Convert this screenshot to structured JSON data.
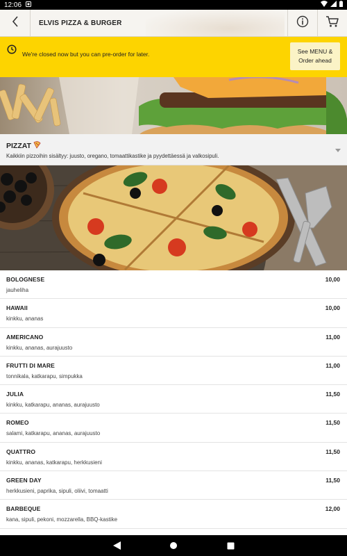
{
  "status_bar": {
    "time": "12:06",
    "icons": [
      "notification-icon",
      "wifi-icon",
      "signal-icon",
      "battery-icon"
    ]
  },
  "header": {
    "title": "ELVIS PIZZA & BURGER",
    "back_icon": "chevron-left-icon",
    "info_icon": "info-icon",
    "cart_icon": "cart-icon"
  },
  "closed_banner": {
    "message": "We're closed now but you can pre-order for later.",
    "button_line1": "See MENU &",
    "button_line2": "Order ahead",
    "background": "#fdd400"
  },
  "category": {
    "title": "PIZZAT",
    "title_icon": "pizza-icon",
    "description": "Kaikkiin pizzoihin sisältyy: juusto, oregano, tomaattikastike ja pyydettäessä ja valkosipuli."
  },
  "menu_items": [
    {
      "name": "BOLOGNESE",
      "desc": "jauheliha",
      "price": "10,00"
    },
    {
      "name": "HAWAII",
      "desc": "kinkku, ananas",
      "price": "10,00"
    },
    {
      "name": "AMERICANO",
      "desc": "kinkku, ananas, aurajuusto",
      "price": "11,00"
    },
    {
      "name": "FRUTTI DI MARE",
      "desc": "tonnikala, katkarapu, simpukka",
      "price": "11,00"
    },
    {
      "name": "JULIA",
      "desc": "kinkku, katkarapu, ananas, aurajuusto",
      "price": "11,50"
    },
    {
      "name": "ROMEO",
      "desc": "salami, katkarapu, ananas, aurajuusto",
      "price": "11,50"
    },
    {
      "name": "QUATTRO",
      "desc": "kinkku, ananas, katkarapu, herkkusieni",
      "price": "11,50"
    },
    {
      "name": "GREEN DAY",
      "desc": "herkkusieni, paprika, sipuli, oliivi, tomaatti",
      "price": "11,50"
    },
    {
      "name": "BARBEQUE",
      "desc": "kana, sipuli, pekoni, mozzarella, BBQ-kastike",
      "price": "12,00"
    }
  ],
  "nav": {
    "back_icon": "nav-back-icon",
    "home_icon": "nav-home-icon",
    "recents_icon": "nav-recents-icon"
  }
}
